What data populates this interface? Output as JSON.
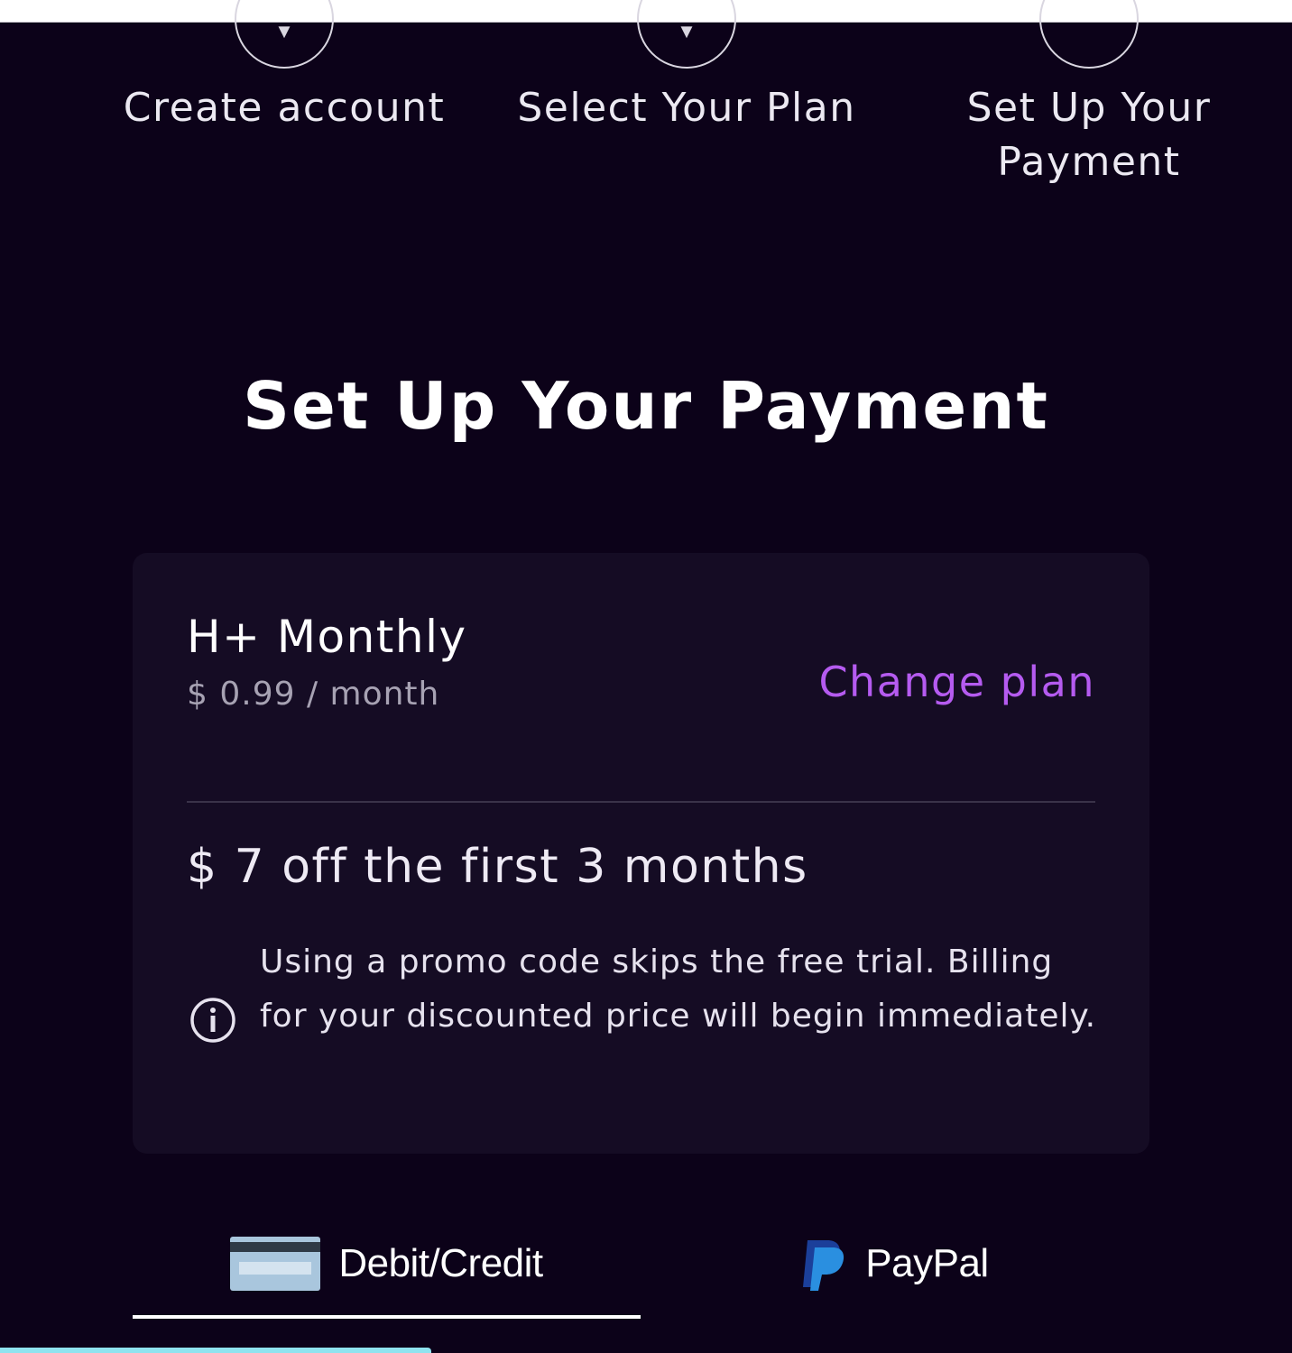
{
  "stepper": {
    "steps": [
      {
        "label": "Create account",
        "icon": "check-icon"
      },
      {
        "label": "Select Your Plan",
        "icon": "check-icon"
      },
      {
        "label": "Set Up Your Payment",
        "icon": "step-number-icon"
      }
    ]
  },
  "page": {
    "title": "Set Up Your Payment"
  },
  "plan_card": {
    "plan_name": "H+ Monthly",
    "price": "$ 0.99 / month",
    "change_plan_label": "Change plan",
    "promo_text": "$ 7 off the first 3 months",
    "notice_text": "Using a promo code skips the free trial. Billing for your discounted price will begin immediately.",
    "notice_icon": "info-icon"
  },
  "payment_tabs": [
    {
      "label": "Debit/Credit",
      "icon": "credit-card-icon",
      "selected": true
    },
    {
      "label": "PayPal",
      "icon": "paypal-icon",
      "selected": false
    }
  ],
  "colors": {
    "background": "#0c0219",
    "card": "#150c24",
    "accent": "#b55bf0",
    "muted_text": "#a7a2b3"
  }
}
